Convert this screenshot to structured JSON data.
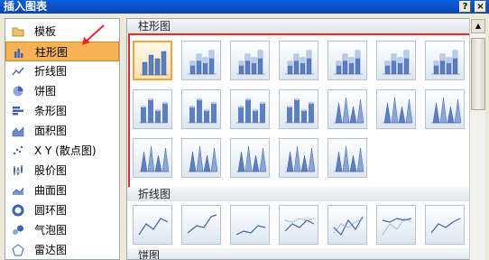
{
  "window": {
    "title": "插入图表",
    "help_label": "?",
    "close_label": "×"
  },
  "sidebar": {
    "items": [
      {
        "label": "模板",
        "icon": "folder-icon"
      },
      {
        "label": "柱形图",
        "icon": "column-chart-icon",
        "selected": true
      },
      {
        "label": "折线图",
        "icon": "line-chart-icon"
      },
      {
        "label": "饼图",
        "icon": "pie-chart-icon"
      },
      {
        "label": "条形图",
        "icon": "bar-chart-icon"
      },
      {
        "label": "面积图",
        "icon": "area-chart-icon"
      },
      {
        "label": "X Y (散点图)",
        "icon": "scatter-chart-icon"
      },
      {
        "label": "股价图",
        "icon": "stock-chart-icon"
      },
      {
        "label": "曲面图",
        "icon": "surface-chart-icon"
      },
      {
        "label": "圆环图",
        "icon": "doughnut-chart-icon"
      },
      {
        "label": "气泡图",
        "icon": "bubble-chart-icon"
      },
      {
        "label": "雷达图",
        "icon": "radar-chart-icon"
      }
    ]
  },
  "main": {
    "sections": [
      {
        "title": "柱形图",
        "thumbnail_count": 19,
        "selected_index": 0
      },
      {
        "title": "折线图",
        "thumbnail_count": 7
      },
      {
        "title": "饼图",
        "thumbnail_count": 0
      }
    ]
  },
  "colors": {
    "accent": "#f6b254",
    "highlight_box": "#e8282b",
    "title_bar": "#0a5fd8",
    "column_fill": "#5b7fc0"
  }
}
